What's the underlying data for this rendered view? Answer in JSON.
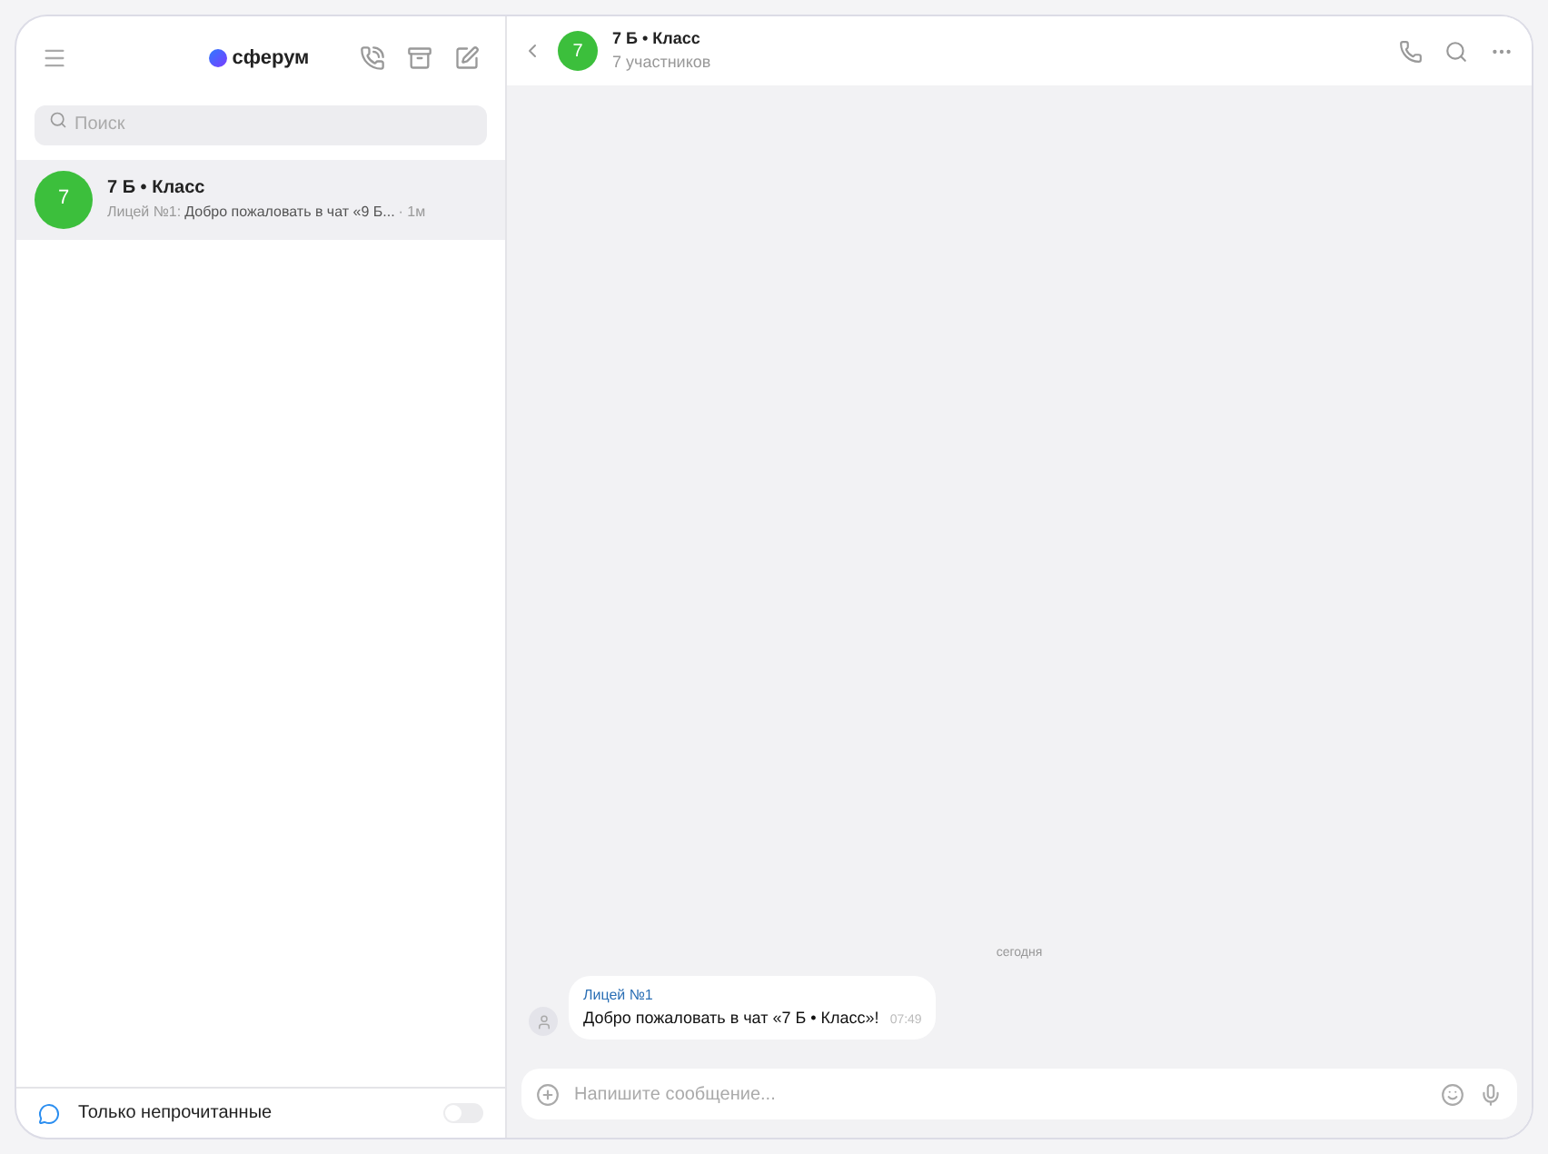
{
  "sidebar": {
    "logo": "сферум",
    "search": {
      "placeholder": "Поиск"
    },
    "chats": [
      {
        "avatar": "7",
        "title": "7 Б • Класс",
        "sender": "Лицей №1:",
        "preview": "Добро пожаловать в чат «9 Б...",
        "time": "· 1м",
        "selected": true
      }
    ],
    "unread_filter": {
      "label": "Только непрочитанные",
      "on": false
    }
  },
  "chat": {
    "avatar": "7",
    "title": "7 Б • Класс",
    "subtitle": "7 участников",
    "date_separator": "сегодня",
    "messages": [
      {
        "sender": "Лицей №1",
        "text": "Добро пожаловать в чат «7 Б • Класс»!",
        "time": "07:49"
      }
    ],
    "composer": {
      "placeholder": "Напишите сообщение..."
    }
  }
}
